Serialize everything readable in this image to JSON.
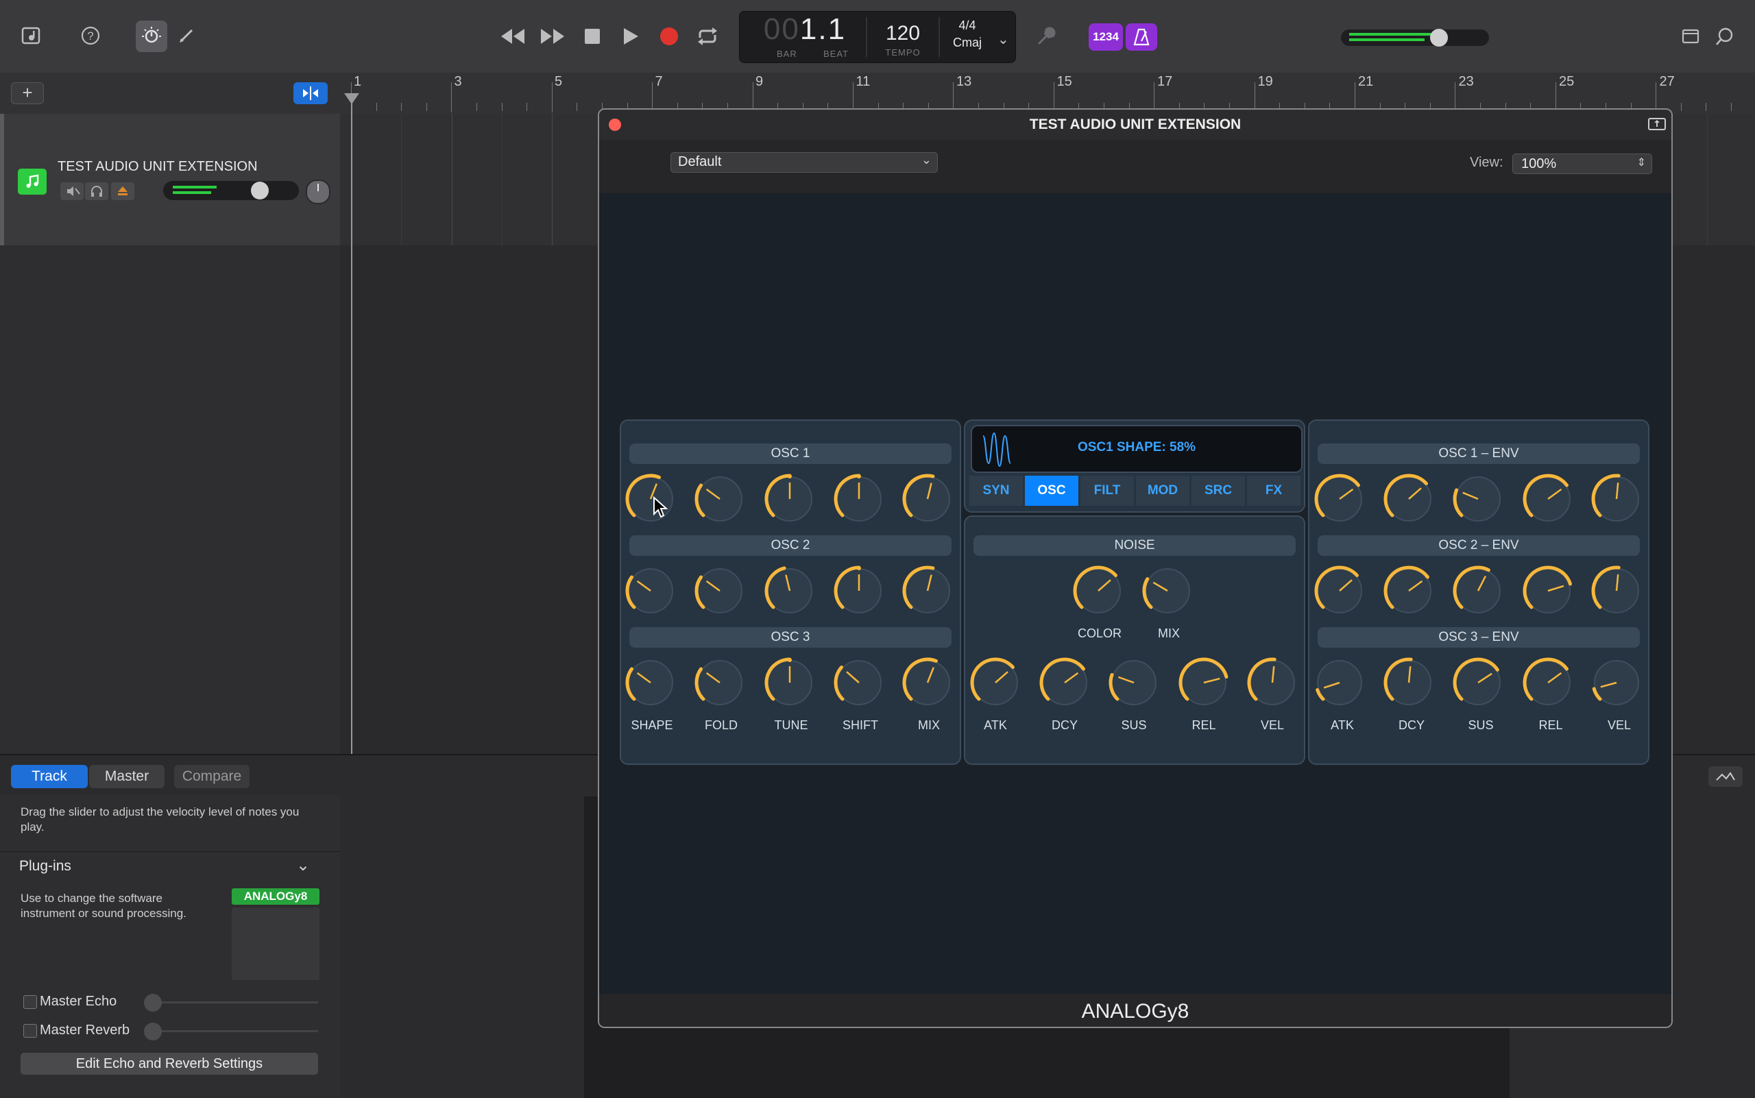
{
  "colors": {
    "accent": "#0a84ff",
    "knob": "#f6b73c",
    "record": "#e0342f",
    "green": "#2ecc40",
    "purple": "#8e2fd6"
  },
  "toolbar": {
    "lcd": {
      "bar_value": "1",
      "beat_value": "1",
      "bar_label": "BAR",
      "beat_label": "BEAT",
      "tempo": "120",
      "tempo_label": "TEMPO",
      "signature": "4/4",
      "key": "Cmaj",
      "bar_dim": "00"
    },
    "count_in": "1234",
    "master_volume_level": 0.62
  },
  "ruler": {
    "bars": [
      "1",
      "3",
      "5",
      "7",
      "9",
      "11",
      "13",
      "15",
      "17",
      "19",
      "21",
      "23",
      "25",
      "27"
    ]
  },
  "track": {
    "name": "TEST AUDIO UNIT EXTENSION",
    "volume_level": 0.62
  },
  "bottom": {
    "tabs": [
      "Track",
      "Master",
      "Compare"
    ],
    "hint": "Drag the slider to adjust the velocity level of notes you play.",
    "plugins_heading": "Plug-ins",
    "plugins_desc": "Use to change the software instrument or sound processing.",
    "plugin_slot": "ANALOGy8",
    "master_echo": "Master Echo",
    "master_reverb": "Master Reverb",
    "edit_button": "Edit Echo and Reverb Settings"
  },
  "plugin": {
    "window_title": "TEST AUDIO UNIT EXTENSION",
    "preset": "Default",
    "view_label": "View:",
    "view_value": "100%",
    "footer": "ANALOGy8",
    "display_text": "OSC1 SHAPE: 58%",
    "tabs": [
      "SYN",
      "OSC",
      "FILT",
      "MOD",
      "SRC",
      "FX"
    ],
    "active_tab": "OSC",
    "osc_sections": [
      "OSC 1",
      "OSC 2",
      "OSC 3"
    ],
    "osc_labels": [
      "SHAPE",
      "FOLD",
      "TUNE",
      "SHIFT",
      "MIX"
    ],
    "noise_section": "NOISE",
    "noise_labels": [
      "COLOR",
      "MIX"
    ],
    "env_labels": [
      "ATK",
      "DCY",
      "SUS",
      "REL",
      "VEL"
    ],
    "env_sections": [
      "OSC 1 – ENV",
      "OSC 2 – ENV",
      "OSC 3 – ENV"
    ],
    "osc_knobs": [
      [
        0.58,
        0.3,
        0.5,
        0.5,
        0.55
      ],
      [
        0.3,
        0.3,
        0.45,
        0.5,
        0.55
      ],
      [
        0.3,
        0.3,
        0.5,
        0.32,
        0.58
      ]
    ],
    "center_env_knobs": [
      0.68,
      0.7,
      0.24,
      0.78,
      0.52
    ],
    "noise_knobs": [
      0.68,
      0.28
    ],
    "env_knobs": [
      [
        0.7,
        0.68,
        0.25,
        0.7,
        0.52
      ],
      [
        0.68,
        0.7,
        0.6,
        0.77,
        0.52
      ],
      [
        0.1,
        0.52,
        0.71,
        0.7,
        0.11
      ]
    ]
  }
}
